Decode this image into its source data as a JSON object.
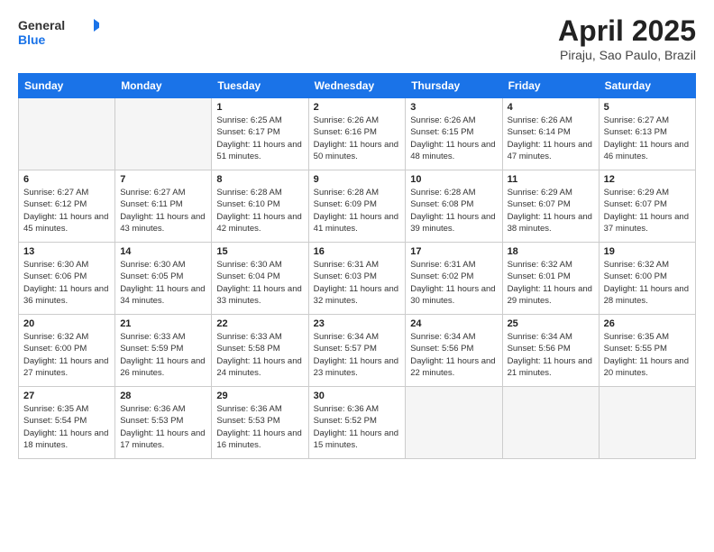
{
  "logo": {
    "general": "General",
    "blue": "Blue"
  },
  "title": "April 2025",
  "subtitle": "Piraju, Sao Paulo, Brazil",
  "weekdays": [
    "Sunday",
    "Monday",
    "Tuesday",
    "Wednesday",
    "Thursday",
    "Friday",
    "Saturday"
  ],
  "weeks": [
    [
      {
        "day": "",
        "sunrise": "",
        "sunset": "",
        "daylight": ""
      },
      {
        "day": "",
        "sunrise": "",
        "sunset": "",
        "daylight": ""
      },
      {
        "day": "1",
        "sunrise": "Sunrise: 6:25 AM",
        "sunset": "Sunset: 6:17 PM",
        "daylight": "Daylight: 11 hours and 51 minutes."
      },
      {
        "day": "2",
        "sunrise": "Sunrise: 6:26 AM",
        "sunset": "Sunset: 6:16 PM",
        "daylight": "Daylight: 11 hours and 50 minutes."
      },
      {
        "day": "3",
        "sunrise": "Sunrise: 6:26 AM",
        "sunset": "Sunset: 6:15 PM",
        "daylight": "Daylight: 11 hours and 48 minutes."
      },
      {
        "day": "4",
        "sunrise": "Sunrise: 6:26 AM",
        "sunset": "Sunset: 6:14 PM",
        "daylight": "Daylight: 11 hours and 47 minutes."
      },
      {
        "day": "5",
        "sunrise": "Sunrise: 6:27 AM",
        "sunset": "Sunset: 6:13 PM",
        "daylight": "Daylight: 11 hours and 46 minutes."
      }
    ],
    [
      {
        "day": "6",
        "sunrise": "Sunrise: 6:27 AM",
        "sunset": "Sunset: 6:12 PM",
        "daylight": "Daylight: 11 hours and 45 minutes."
      },
      {
        "day": "7",
        "sunrise": "Sunrise: 6:27 AM",
        "sunset": "Sunset: 6:11 PM",
        "daylight": "Daylight: 11 hours and 43 minutes."
      },
      {
        "day": "8",
        "sunrise": "Sunrise: 6:28 AM",
        "sunset": "Sunset: 6:10 PM",
        "daylight": "Daylight: 11 hours and 42 minutes."
      },
      {
        "day": "9",
        "sunrise": "Sunrise: 6:28 AM",
        "sunset": "Sunset: 6:09 PM",
        "daylight": "Daylight: 11 hours and 41 minutes."
      },
      {
        "day": "10",
        "sunrise": "Sunrise: 6:28 AM",
        "sunset": "Sunset: 6:08 PM",
        "daylight": "Daylight: 11 hours and 39 minutes."
      },
      {
        "day": "11",
        "sunrise": "Sunrise: 6:29 AM",
        "sunset": "Sunset: 6:07 PM",
        "daylight": "Daylight: 11 hours and 38 minutes."
      },
      {
        "day": "12",
        "sunrise": "Sunrise: 6:29 AM",
        "sunset": "Sunset: 6:07 PM",
        "daylight": "Daylight: 11 hours and 37 minutes."
      }
    ],
    [
      {
        "day": "13",
        "sunrise": "Sunrise: 6:30 AM",
        "sunset": "Sunset: 6:06 PM",
        "daylight": "Daylight: 11 hours and 36 minutes."
      },
      {
        "day": "14",
        "sunrise": "Sunrise: 6:30 AM",
        "sunset": "Sunset: 6:05 PM",
        "daylight": "Daylight: 11 hours and 34 minutes."
      },
      {
        "day": "15",
        "sunrise": "Sunrise: 6:30 AM",
        "sunset": "Sunset: 6:04 PM",
        "daylight": "Daylight: 11 hours and 33 minutes."
      },
      {
        "day": "16",
        "sunrise": "Sunrise: 6:31 AM",
        "sunset": "Sunset: 6:03 PM",
        "daylight": "Daylight: 11 hours and 32 minutes."
      },
      {
        "day": "17",
        "sunrise": "Sunrise: 6:31 AM",
        "sunset": "Sunset: 6:02 PM",
        "daylight": "Daylight: 11 hours and 30 minutes."
      },
      {
        "day": "18",
        "sunrise": "Sunrise: 6:32 AM",
        "sunset": "Sunset: 6:01 PM",
        "daylight": "Daylight: 11 hours and 29 minutes."
      },
      {
        "day": "19",
        "sunrise": "Sunrise: 6:32 AM",
        "sunset": "Sunset: 6:00 PM",
        "daylight": "Daylight: 11 hours and 28 minutes."
      }
    ],
    [
      {
        "day": "20",
        "sunrise": "Sunrise: 6:32 AM",
        "sunset": "Sunset: 6:00 PM",
        "daylight": "Daylight: 11 hours and 27 minutes."
      },
      {
        "day": "21",
        "sunrise": "Sunrise: 6:33 AM",
        "sunset": "Sunset: 5:59 PM",
        "daylight": "Daylight: 11 hours and 26 minutes."
      },
      {
        "day": "22",
        "sunrise": "Sunrise: 6:33 AM",
        "sunset": "Sunset: 5:58 PM",
        "daylight": "Daylight: 11 hours and 24 minutes."
      },
      {
        "day": "23",
        "sunrise": "Sunrise: 6:34 AM",
        "sunset": "Sunset: 5:57 PM",
        "daylight": "Daylight: 11 hours and 23 minutes."
      },
      {
        "day": "24",
        "sunrise": "Sunrise: 6:34 AM",
        "sunset": "Sunset: 5:56 PM",
        "daylight": "Daylight: 11 hours and 22 minutes."
      },
      {
        "day": "25",
        "sunrise": "Sunrise: 6:34 AM",
        "sunset": "Sunset: 5:56 PM",
        "daylight": "Daylight: 11 hours and 21 minutes."
      },
      {
        "day": "26",
        "sunrise": "Sunrise: 6:35 AM",
        "sunset": "Sunset: 5:55 PM",
        "daylight": "Daylight: 11 hours and 20 minutes."
      }
    ],
    [
      {
        "day": "27",
        "sunrise": "Sunrise: 6:35 AM",
        "sunset": "Sunset: 5:54 PM",
        "daylight": "Daylight: 11 hours and 18 minutes."
      },
      {
        "day": "28",
        "sunrise": "Sunrise: 6:36 AM",
        "sunset": "Sunset: 5:53 PM",
        "daylight": "Daylight: 11 hours and 17 minutes."
      },
      {
        "day": "29",
        "sunrise": "Sunrise: 6:36 AM",
        "sunset": "Sunset: 5:53 PM",
        "daylight": "Daylight: 11 hours and 16 minutes."
      },
      {
        "day": "30",
        "sunrise": "Sunrise: 6:36 AM",
        "sunset": "Sunset: 5:52 PM",
        "daylight": "Daylight: 11 hours and 15 minutes."
      },
      {
        "day": "",
        "sunrise": "",
        "sunset": "",
        "daylight": ""
      },
      {
        "day": "",
        "sunrise": "",
        "sunset": "",
        "daylight": ""
      },
      {
        "day": "",
        "sunrise": "",
        "sunset": "",
        "daylight": ""
      }
    ]
  ]
}
